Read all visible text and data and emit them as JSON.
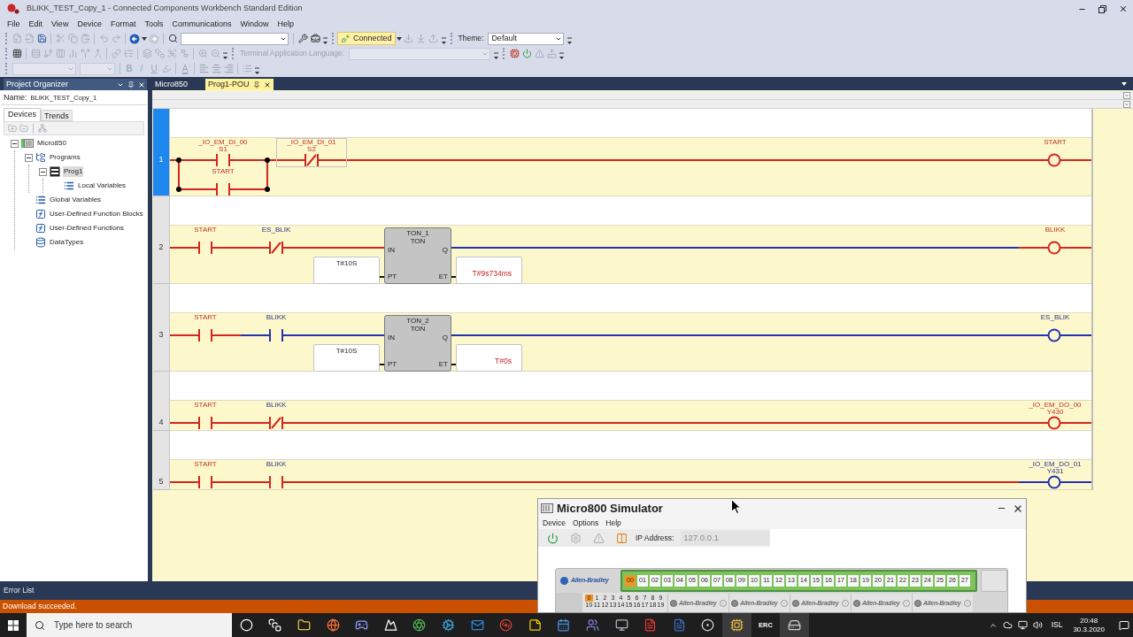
{
  "window": {
    "title": "BLIKK_TEST_Copy_1 - Connected Components Workbench Standard Edition"
  },
  "menu": [
    "File",
    "Edit",
    "View",
    "Device",
    "Format",
    "Tools",
    "Communications",
    "Window",
    "Help"
  ],
  "toolbars": [
    {
      "items": [
        {
          "kind": "grip"
        },
        {
          "kind": "import",
          "disabled": true
        },
        {
          "kind": "export",
          "disabled": true
        },
        {
          "kind": "save",
          "disabled": false
        },
        {
          "kind": "sep"
        },
        {
          "kind": "cut",
          "disabled": true
        },
        {
          "kind": "copy",
          "disabled": true
        },
        {
          "kind": "paste",
          "disabled": true
        },
        {
          "kind": "sep"
        },
        {
          "kind": "undo",
          "disabled": true
        },
        {
          "kind": "redo",
          "disabled": true
        },
        {
          "kind": "sep"
        },
        {
          "kind": "back",
          "disabled": false
        },
        {
          "kind": "caret"
        },
        {
          "kind": "forward",
          "disabled": true
        },
        {
          "kind": "sep"
        },
        {
          "kind": "find",
          "disabled": false
        },
        {
          "kind": "search-combo",
          "disabled": false
        },
        {
          "kind": "sep"
        },
        {
          "kind": "wrench",
          "disabled": false
        },
        {
          "kind": "toolbox",
          "disabled": false
        },
        {
          "kind": "overflow"
        },
        {
          "kind": "grip"
        },
        {
          "kind": "connection",
          "label": "Connected",
          "connected": true
        },
        {
          "kind": "caret"
        },
        {
          "kind": "download",
          "disabled": true
        },
        {
          "kind": "download-alt",
          "disabled": true
        },
        {
          "kind": "upload",
          "disabled": true
        },
        {
          "kind": "overflow"
        },
        {
          "kind": "grip"
        },
        {
          "kind": "label",
          "text": "Theme:",
          "disabled": false
        },
        {
          "kind": "theme-combo",
          "value": "Default",
          "disabled": false
        },
        {
          "kind": "overflow"
        }
      ]
    },
    {
      "items": [
        {
          "kind": "grip"
        },
        {
          "kind": "grid",
          "disabled": false
        },
        {
          "kind": "sep"
        },
        {
          "kind": "rows",
          "disabled": true
        },
        {
          "kind": "branch",
          "disabled": true
        },
        {
          "kind": "columns",
          "disabled": true
        },
        {
          "kind": "bars",
          "disabled": true
        },
        {
          "kind": "split",
          "disabled": true
        },
        {
          "kind": "merge",
          "disabled": true
        },
        {
          "kind": "sep"
        },
        {
          "kind": "link",
          "disabled": true
        },
        {
          "kind": "tree",
          "disabled": true
        },
        {
          "kind": "sep"
        },
        {
          "kind": "layers",
          "disabled": true
        },
        {
          "kind": "stack",
          "disabled": true
        },
        {
          "kind": "group",
          "disabled": true
        },
        {
          "kind": "ungroup",
          "disabled": true
        },
        {
          "kind": "sep"
        },
        {
          "kind": "zoom-in",
          "disabled": true
        },
        {
          "kind": "zoom-out",
          "disabled": true
        },
        {
          "kind": "overflow"
        },
        {
          "kind": "grip"
        },
        {
          "kind": "label",
          "text": "Terminal Application Language:",
          "disabled": true
        },
        {
          "kind": "language-combo",
          "disabled": true
        },
        {
          "kind": "overflow"
        },
        {
          "kind": "grip"
        },
        {
          "kind": "simulator",
          "disabled": false
        },
        {
          "kind": "power",
          "disabled": false
        },
        {
          "kind": "warning",
          "disabled": true
        },
        {
          "kind": "controller-upload",
          "disabled": true
        },
        {
          "kind": "overflow"
        }
      ]
    },
    {
      "items": [
        {
          "kind": "grip"
        },
        {
          "kind": "font-combo",
          "disabled": true
        },
        {
          "kind": "size-combo",
          "disabled": true
        },
        {
          "kind": "sep"
        },
        {
          "kind": "bold",
          "text": "B",
          "disabled": true
        },
        {
          "kind": "italic",
          "text": "I",
          "disabled": true
        },
        {
          "kind": "underline",
          "text": "U",
          "disabled": true
        },
        {
          "kind": "highlight",
          "disabled": true
        },
        {
          "kind": "sep"
        },
        {
          "kind": "font-color",
          "text": "A",
          "disabled": true
        },
        {
          "kind": "sep"
        },
        {
          "kind": "align-left",
          "disabled": true
        },
        {
          "kind": "align-center",
          "disabled": true
        },
        {
          "kind": "align-right",
          "disabled": true
        },
        {
          "kind": "sep"
        },
        {
          "kind": "list",
          "disabled": true
        },
        {
          "kind": "overflow"
        }
      ]
    }
  ],
  "project_organizer": {
    "title": "Project Organizer",
    "name_label": "Name:",
    "name_value": "BLIKK_TEST_Copy_1",
    "tabs": [
      {
        "label": "Devices",
        "selected": true
      },
      {
        "label": "Trends",
        "selected": false
      }
    ],
    "toolbar": [
      {
        "kind": "add",
        "disabled": true
      },
      {
        "kind": "remove",
        "disabled": true
      },
      {
        "kind": "sep"
      },
      {
        "kind": "network",
        "disabled": true
      }
    ],
    "tree": [
      {
        "label": "Micro850",
        "kind": "controller",
        "expanded": true,
        "selected": false,
        "children": [
          {
            "label": "Programs",
            "kind": "programs",
            "expanded": true,
            "selected": false,
            "children": [
              {
                "label": "Prog1",
                "kind": "program",
                "expanded": true,
                "selected": true,
                "children": [
                  {
                    "label": "Local Variables",
                    "kind": "variables",
                    "selected": false
                  }
                ]
              }
            ]
          },
          {
            "label": "Global Variables",
            "kind": "variables",
            "selected": false
          },
          {
            "label": "User-Defined Function Blocks",
            "kind": "function-blocks",
            "selected": false
          },
          {
            "label": "User-Defined Functions",
            "kind": "functions",
            "selected": false
          },
          {
            "label": "DataTypes",
            "kind": "datatypes",
            "selected": false
          }
        ]
      }
    ]
  },
  "editor_tabs": [
    {
      "label": "Micro850",
      "selected": false
    },
    {
      "label": "Prog1-POU",
      "selected": true
    }
  ],
  "rungs": [
    {
      "number": "1",
      "selected": true,
      "elements": [
        {
          "kind": "branch",
          "contacts": [
            {
              "kind": "no-contact",
              "labels": [
                "_IO_EM_DI_00",
                "S1"
              ],
              "value": true,
              "power": true,
              "selected": false
            },
            {
              "kind": "no-contact",
              "labels": [
                "START"
              ],
              "value": true,
              "power": true,
              "selected": false
            }
          ]
        },
        {
          "kind": "nc-contact",
          "labels": [
            "_IO_EM_DI_01",
            "S2"
          ],
          "value": true,
          "power": true,
          "selected": true
        },
        {
          "kind": "coil",
          "labels": [
            "START"
          ],
          "value": true,
          "power": true,
          "selected": false
        }
      ]
    },
    {
      "number": "2",
      "selected": false,
      "elements": [
        {
          "kind": "no-contact",
          "labels": [
            "START"
          ],
          "value": true,
          "power": true,
          "selected": false
        },
        {
          "kind": "nc-contact",
          "labels": [
            "ES_BLIK"
          ],
          "value": false,
          "power": true,
          "selected": false
        },
        {
          "kind": "block",
          "instance": "TON_1",
          "function": "TON",
          "inputs": [
            "IN",
            "PT"
          ],
          "outputs": [
            "Q",
            "ET"
          ],
          "pt_value": "T#10S",
          "et_value": "T#9s734ms",
          "q_power": false,
          "selected": false
        },
        {
          "kind": "coil",
          "labels": [
            "BLIKK"
          ],
          "value": true,
          "power": true,
          "selected": false
        }
      ]
    },
    {
      "number": "3",
      "selected": false,
      "elements": [
        {
          "kind": "no-contact",
          "labels": [
            "START"
          ],
          "value": true,
          "power": true,
          "selected": false
        },
        {
          "kind": "no-contact",
          "labels": [
            "BLIKK"
          ],
          "value": false,
          "power": false,
          "selected": false
        },
        {
          "kind": "block",
          "instance": "TON_2",
          "function": "TON",
          "inputs": [
            "IN",
            "PT"
          ],
          "outputs": [
            "Q",
            "ET"
          ],
          "pt_value": "T#10S",
          "et_value": "T#0s",
          "q_power": false,
          "selected": false
        },
        {
          "kind": "coil",
          "labels": [
            "ES_BLIK"
          ],
          "value": false,
          "power": false,
          "selected": false
        }
      ]
    },
    {
      "number": "4",
      "selected": false,
      "elements": [
        {
          "kind": "no-contact",
          "labels": [
            "START"
          ],
          "value": true,
          "power": true,
          "selected": false
        },
        {
          "kind": "nc-contact",
          "labels": [
            "BLIKK"
          ],
          "value": false,
          "power": true,
          "selected": false
        },
        {
          "kind": "coil",
          "labels": [
            "_IO_EM_DO_00",
            "Y430"
          ],
          "value": true,
          "power": true,
          "selected": false
        }
      ]
    },
    {
      "number": "5",
      "selected": false,
      "elements": [
        {
          "kind": "no-contact",
          "labels": [
            "START"
          ],
          "value": true,
          "power": true,
          "selected": false
        },
        {
          "kind": "no-contact",
          "labels": [
            "BLIKK"
          ],
          "value": false,
          "power": true,
          "selected": false
        },
        {
          "kind": "coil",
          "labels": [
            "_IO_EM_DO_01",
            "Y431"
          ],
          "value": false,
          "power": false,
          "selected": false
        }
      ]
    }
  ],
  "error_panel": {
    "title": "Error List"
  },
  "status_bar": {
    "message": "Download succeeded."
  },
  "simulator": {
    "title": "Micro800 Simulator",
    "menu": [
      "Device",
      "Options",
      "Help"
    ],
    "toolbar": [
      {
        "kind": "power",
        "disabled": false
      },
      {
        "kind": "settings",
        "disabled": true
      },
      {
        "kind": "warning",
        "disabled": true
      },
      {
        "kind": "device",
        "disabled": false
      }
    ],
    "ip_label": "IP Address:",
    "ip_value": "127.0.0.1",
    "ip_disabled": true,
    "brand": "Allen-Bradley",
    "outputs": [
      {
        "label": "00",
        "on": true
      },
      {
        "label": "01",
        "on": false
      },
      {
        "label": "02",
        "on": false
      },
      {
        "label": "03",
        "on": false
      },
      {
        "label": "04",
        "on": false
      },
      {
        "label": "05",
        "on": false
      },
      {
        "label": "06",
        "on": false
      },
      {
        "label": "07",
        "on": false
      },
      {
        "label": "08",
        "on": false
      },
      {
        "label": "09",
        "on": false
      },
      {
        "label": "10",
        "on": false
      },
      {
        "label": "11",
        "on": false
      },
      {
        "label": "12",
        "on": false
      },
      {
        "label": "13",
        "on": false
      },
      {
        "label": "14",
        "on": false
      },
      {
        "label": "15",
        "on": false
      },
      {
        "label": "16",
        "on": false
      },
      {
        "label": "17",
        "on": false
      },
      {
        "label": "18",
        "on": false
      },
      {
        "label": "19",
        "on": false
      },
      {
        "label": "20",
        "on": false
      },
      {
        "label": "21",
        "on": false
      },
      {
        "label": "22",
        "on": false
      },
      {
        "label": "23",
        "on": false
      },
      {
        "label": "24",
        "on": false
      },
      {
        "label": "25",
        "on": false
      },
      {
        "label": "26",
        "on": false
      },
      {
        "label": "27",
        "on": false
      }
    ],
    "inputs": [
      {
        "label": "0",
        "on": true
      },
      {
        "label": "1",
        "on": false
      },
      {
        "label": "2",
        "on": false
      },
      {
        "label": "3",
        "on": false
      },
      {
        "label": "4",
        "on": false
      },
      {
        "label": "5",
        "on": false
      },
      {
        "label": "6",
        "on": false
      },
      {
        "label": "7",
        "on": false
      },
      {
        "label": "8",
        "on": false
      },
      {
        "label": "9",
        "on": false
      },
      {
        "label": "10",
        "on": false
      },
      {
        "label": "11",
        "on": false
      },
      {
        "label": "12",
        "on": false
      },
      {
        "label": "13",
        "on": false
      },
      {
        "label": "14",
        "on": false
      },
      {
        "label": "15",
        "on": false
      },
      {
        "label": "16",
        "on": false
      },
      {
        "label": "17",
        "on": false
      },
      {
        "label": "18",
        "on": false
      },
      {
        "label": "19",
        "on": false
      }
    ],
    "modules": [
      "Allen-Bradley",
      "Allen-Bradley",
      "Allen-Bradley",
      "Allen-Bradley",
      "Allen-Bradley"
    ]
  },
  "taskbar": {
    "search_placeholder": "Type here to search",
    "apps": [
      {
        "kind": "circle",
        "active": false
      },
      {
        "kind": "task-view",
        "active": false
      },
      {
        "kind": "folder",
        "active": false
      },
      {
        "kind": "globe",
        "active": false
      },
      {
        "kind": "gamepad",
        "active": false
      },
      {
        "kind": "mountain",
        "active": false
      },
      {
        "kind": "aperture",
        "active": false
      },
      {
        "kind": "gear",
        "active": false
      },
      {
        "kind": "mail",
        "active": false
      },
      {
        "kind": "disc",
        "active": false
      },
      {
        "kind": "note",
        "active": false
      },
      {
        "kind": "calendar",
        "active": false
      },
      {
        "kind": "people",
        "active": false
      },
      {
        "kind": "monitor",
        "active": false
      },
      {
        "kind": "pdf",
        "active": false
      },
      {
        "kind": "word",
        "active": false
      },
      {
        "kind": "ring",
        "active": false
      },
      {
        "kind": "chip",
        "active": true
      },
      {
        "kind": "text-logo",
        "label": "ERC",
        "active": false
      },
      {
        "kind": "drive",
        "active": true
      }
    ],
    "tray": {
      "language": "ISL",
      "time": "20:48",
      "date": "30.3.2020"
    }
  }
}
